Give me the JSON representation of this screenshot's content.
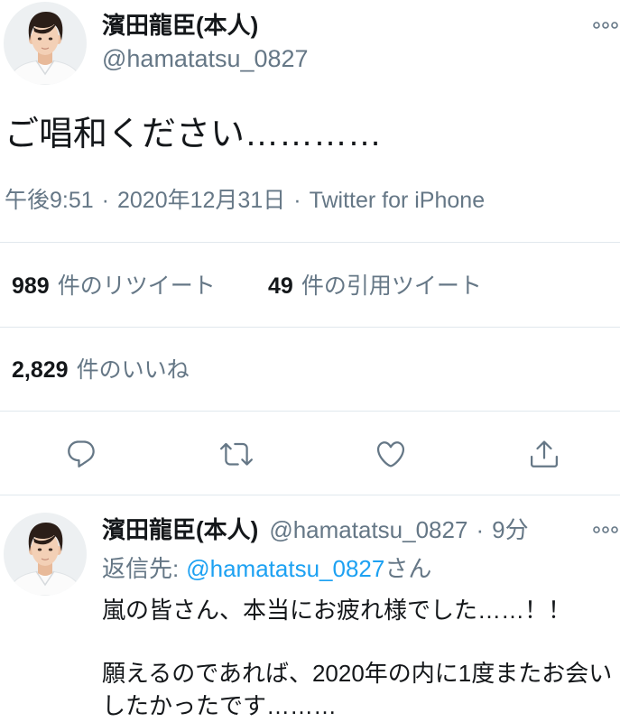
{
  "tweet": {
    "author": {
      "display_name": "濱田龍臣(本人)",
      "handle": "@hamatatsu_0827",
      "avatar_icon": "avatar-icon"
    },
    "more_icon": "more-icon",
    "text": "ご唱和ください…………",
    "meta": {
      "time": "午後9:51",
      "separator": "·",
      "date": "2020年12月31日",
      "source": "Twitter for iPhone"
    },
    "stats": {
      "retweets": {
        "count": "989",
        "label": "件のリツイート"
      },
      "quotes": {
        "count": "49",
        "label": "件の引用ツイート"
      },
      "likes": {
        "count": "2,829",
        "label": "件のいいね"
      }
    },
    "actions": [
      {
        "icon": "reply-icon"
      },
      {
        "icon": "retweet-icon"
      },
      {
        "icon": "like-icon"
      },
      {
        "icon": "share-icon"
      }
    ]
  },
  "reply": {
    "author": {
      "display_name": "濱田龍臣(本人)",
      "handle": "@hamatatsu_0827",
      "avatar_icon": "avatar-icon"
    },
    "separator": "·",
    "time": "9分",
    "more_icon": "more-icon",
    "reply_to": {
      "prefix": "返信先:",
      "handle": "@hamatatsu_0827",
      "suffix": "さん"
    },
    "body_paragraphs": [
      {
        "lines": [
          "嵐の皆さん、本当にお疲れ様でした……！！"
        ]
      },
      {
        "lines": [
          "願えるのであれば、2020年の内に1度またお会い",
          "したかったです………"
        ]
      }
    ]
  },
  "colors": {
    "text": "#14171a",
    "secondary": "#657786",
    "link": "#1da1f2",
    "divider": "#e1e8ed",
    "background": "#ffffff"
  }
}
